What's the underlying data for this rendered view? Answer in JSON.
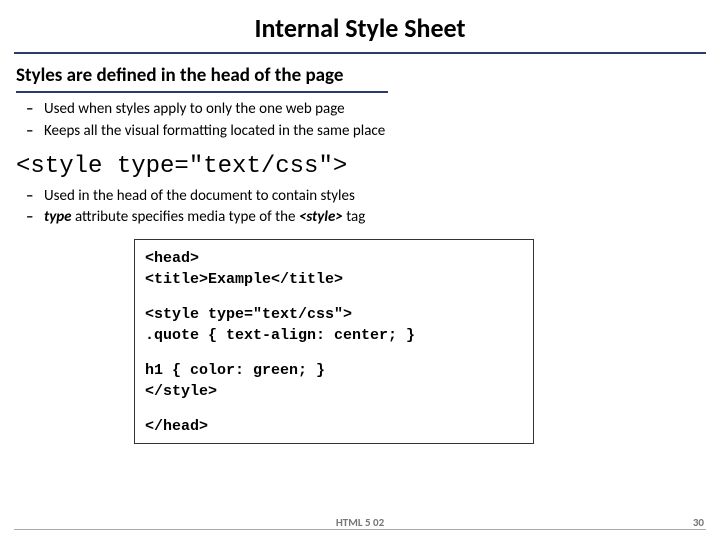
{
  "title": "Internal Style Sheet",
  "lead": "Styles are defined in the head of the page",
  "bullets1": [
    "Used when styles apply to only the one web page",
    "Keeps all the visual formatting located in the same place"
  ],
  "codeLine": "<style type=\"text/css\">",
  "bullets2a": "Used in the head of the document to contain styles",
  "bullets2b_pre": "type",
  "bullets2b_mid": " attribute specifies media type of the ",
  "bullets2b_tag": "<style>",
  "bullets2b_end": " tag",
  "codebox": [
    "<head>",
    "<title>Example</title>",
    "",
    "<style type=\"text/css\">",
    ".quote { text-align: center; }",
    "",
    "h1 { color: green; }",
    "</style>",
    "",
    "</head>"
  ],
  "footer": {
    "center": "HTML 5 02",
    "page": "30"
  }
}
